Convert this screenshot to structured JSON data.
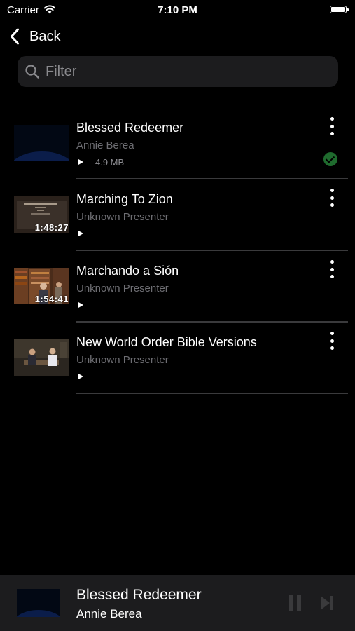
{
  "status_bar": {
    "carrier": "Carrier",
    "time": "7:10 PM"
  },
  "nav": {
    "back_label": "Back"
  },
  "filter": {
    "placeholder": "Filter"
  },
  "items": [
    {
      "title": "Blessed Redeemer",
      "presenter": "Annie Berea",
      "size": "4.9 MB",
      "duration": "",
      "downloaded": true
    },
    {
      "title": "Marching To Zion",
      "presenter": "Unknown Presenter",
      "size": "",
      "duration": "1:48:27",
      "downloaded": false
    },
    {
      "title": "Marchando a Sión",
      "presenter": "Unknown Presenter",
      "size": "",
      "duration": "1:54:41",
      "downloaded": false
    },
    {
      "title": "New World Order Bible Versions",
      "presenter": "Unknown Presenter",
      "size": "",
      "duration": "",
      "downloaded": false
    }
  ],
  "now_playing": {
    "title": "Blessed Redeemer",
    "presenter": "Annie Berea"
  },
  "colors": {
    "background": "#000000",
    "filter_bg": "#1c1c1e",
    "secondary_text": "#6d6d72",
    "check_green": "#1f6b2e",
    "player_bg": "#1c1c1e"
  },
  "icons": {
    "back": "chevron-left-icon",
    "search": "magnifier-icon",
    "more": "vertical-ellipsis-icon",
    "downloaded": "checkmark-circle-icon",
    "play": "play-triangle-icon",
    "pause": "pause-icon",
    "next": "skip-forward-icon"
  }
}
